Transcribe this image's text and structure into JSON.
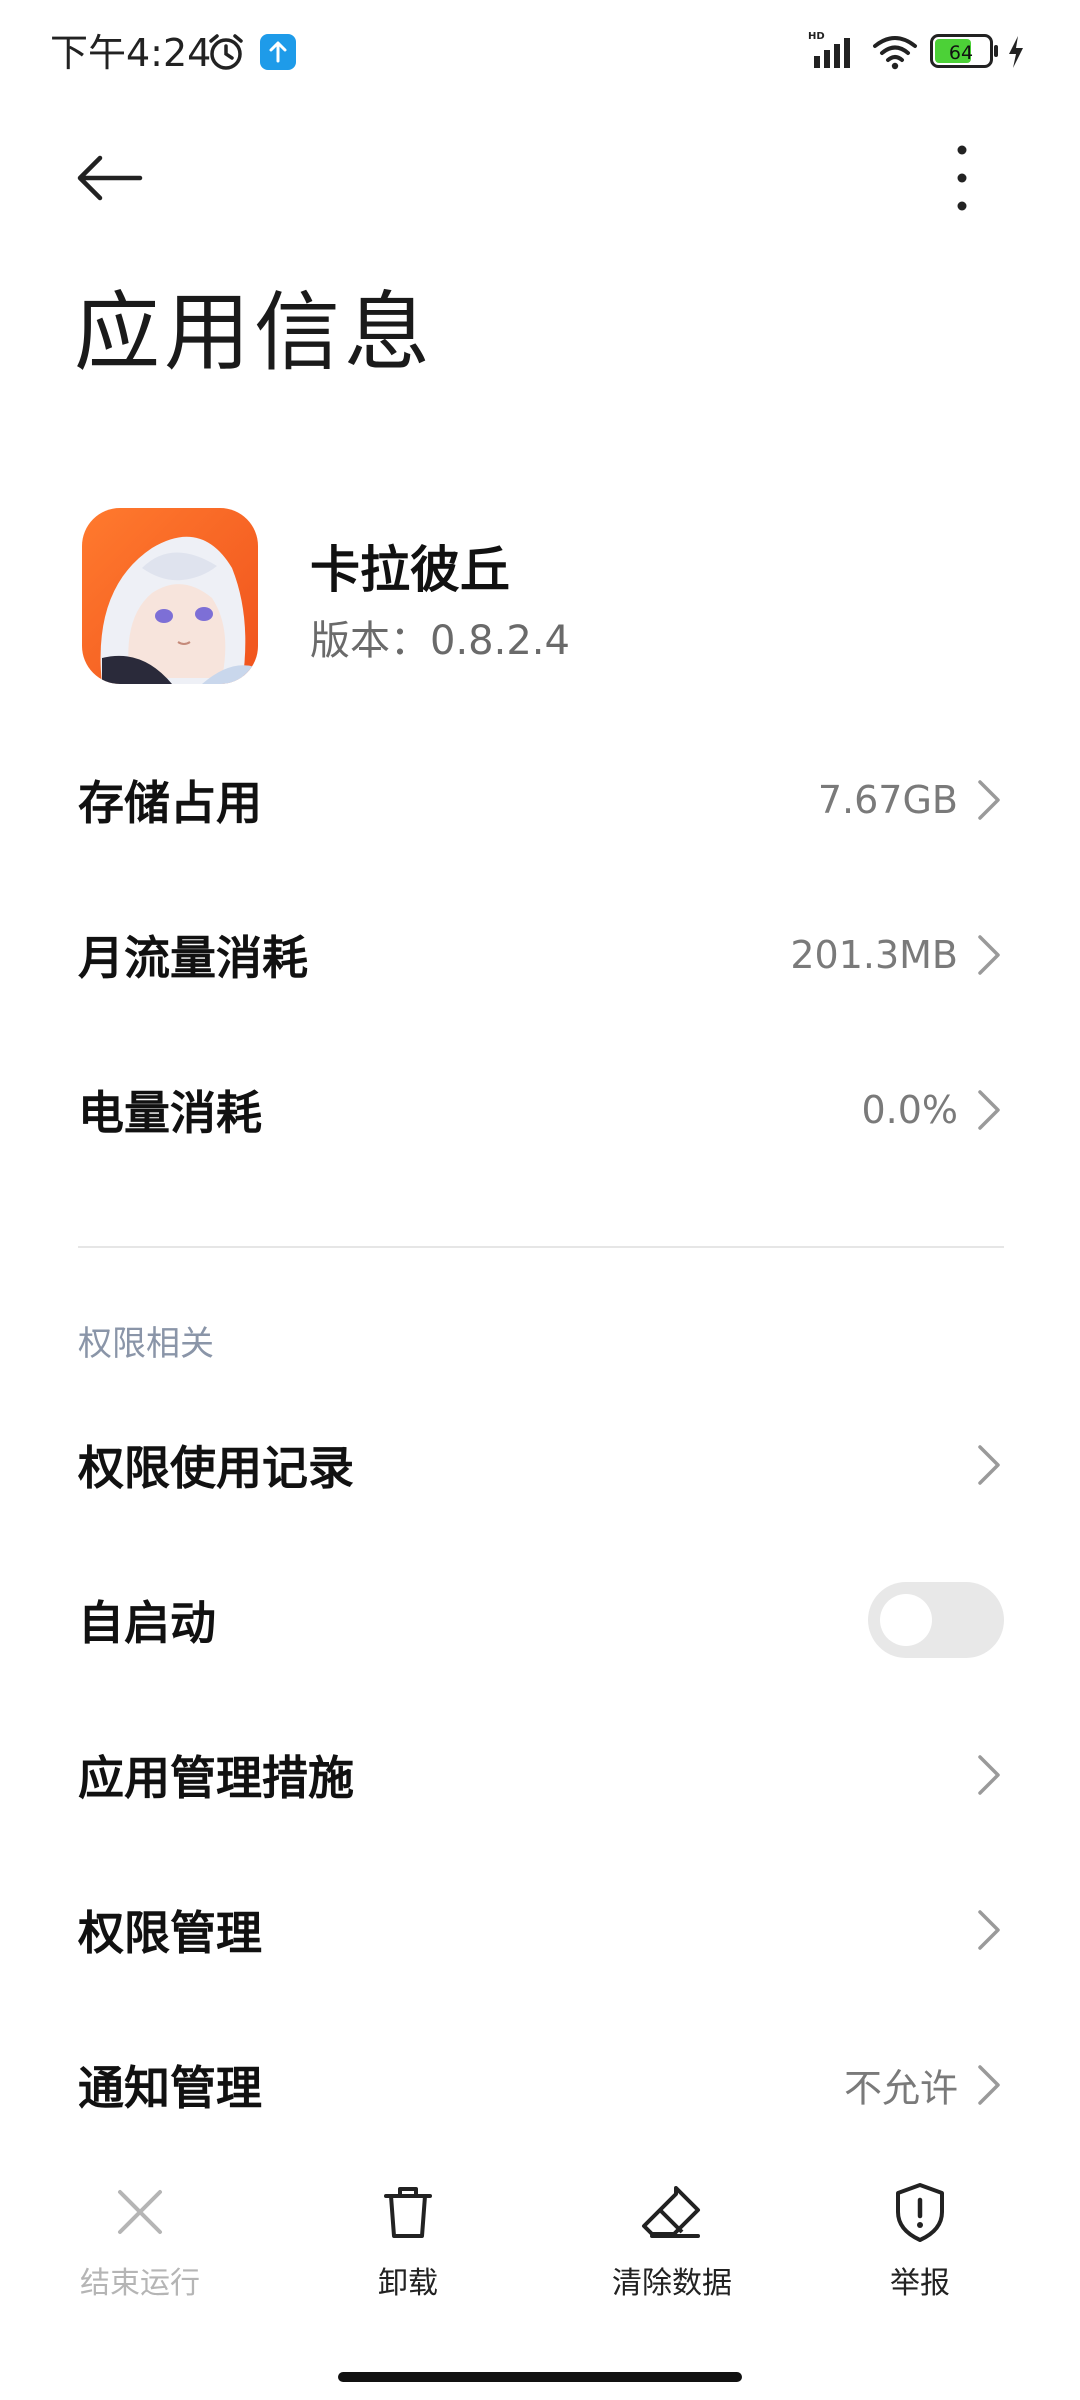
{
  "status_bar": {
    "time": "下午4:24",
    "network_badge": "HD",
    "battery_level": "64",
    "icons": [
      "alarm-icon",
      "upload-icon",
      "signal-icon",
      "wifi-icon",
      "battery-icon",
      "charging-icon"
    ]
  },
  "header": {
    "title": "应用信息"
  },
  "app": {
    "name": "卡拉彼丘",
    "version": "版本：0.8.2.4"
  },
  "usage_rows": [
    {
      "label": "存储占用",
      "value": "7.67GB"
    },
    {
      "label": "月流量消耗",
      "value": "201.3MB"
    },
    {
      "label": "电量消耗",
      "value": "0.0%"
    }
  ],
  "permissions": {
    "section_title": "权限相关",
    "rows": [
      {
        "label": "权限使用记录",
        "value": ""
      },
      {
        "label": "自启动",
        "toggle": false
      },
      {
        "label": "应用管理措施",
        "value": ""
      },
      {
        "label": "权限管理",
        "value": ""
      },
      {
        "label": "通知管理",
        "value": "不允许"
      }
    ]
  },
  "actions": [
    {
      "label": "结束运行",
      "icon": "close-icon",
      "enabled": false
    },
    {
      "label": "卸载",
      "icon": "trash-icon",
      "enabled": true
    },
    {
      "label": "清除数据",
      "icon": "eraser-icon",
      "enabled": true
    },
    {
      "label": "举报",
      "icon": "shield-alert-icon",
      "enabled": true
    }
  ],
  "colors": {
    "accent_upload": "#1e9be9",
    "battery_fill": "#4cd137",
    "section_header": "#8a95a8",
    "toggle_off": "#e8e8e8"
  }
}
